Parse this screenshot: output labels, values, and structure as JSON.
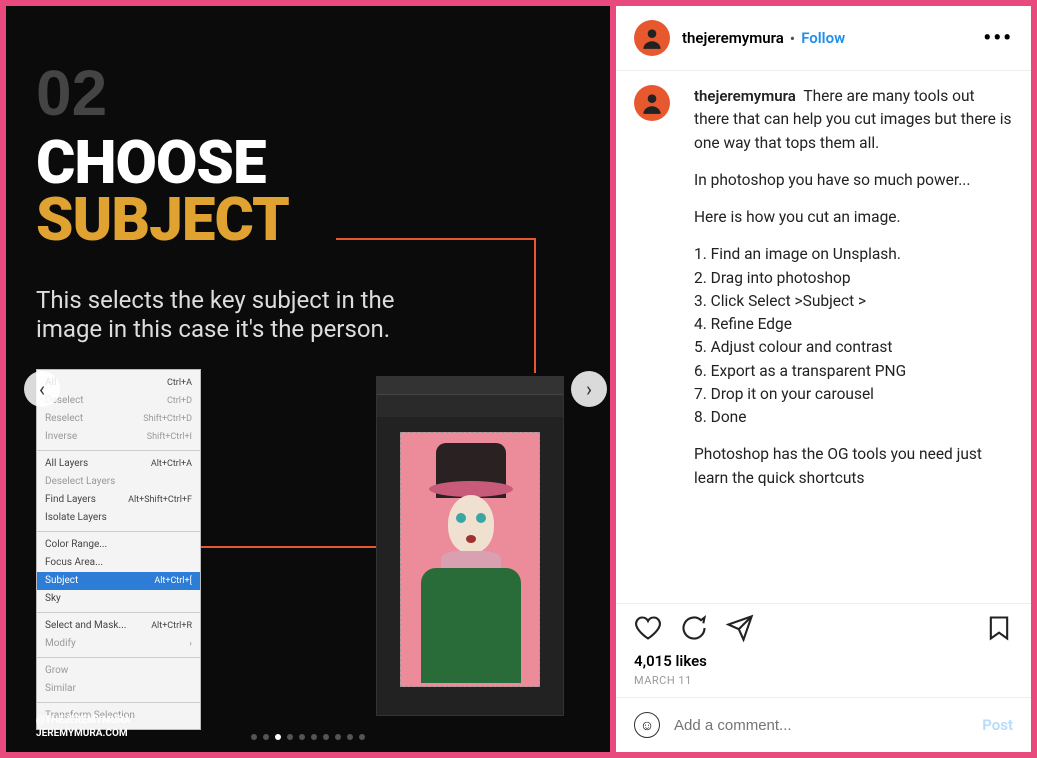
{
  "carousel": {
    "number": "02",
    "title_line1": "CHOOSE",
    "title_line2": "SUBJECT",
    "subtitle": "This selects the key subject in the image in this case it's the person.",
    "menu": [
      {
        "items": [
          {
            "label": "All",
            "sc": "Ctrl+A"
          },
          {
            "label": "Deselect",
            "sc": "Ctrl+D",
            "dim": true
          },
          {
            "label": "Reselect",
            "sc": "Shift+Ctrl+D",
            "dim": true
          },
          {
            "label": "Inverse",
            "sc": "Shift+Ctrl+I",
            "dim": true
          }
        ]
      },
      {
        "items": [
          {
            "label": "All Layers",
            "sc": "Alt+Ctrl+A"
          },
          {
            "label": "Deselect Layers",
            "sc": "",
            "dim": true
          },
          {
            "label": "Find Layers",
            "sc": "Alt+Shift+Ctrl+F"
          },
          {
            "label": "Isolate Layers",
            "sc": ""
          }
        ]
      },
      {
        "items": [
          {
            "label": "Color Range...",
            "sc": ""
          },
          {
            "label": "Focus Area...",
            "sc": ""
          },
          {
            "label": "Subject",
            "sc": "Alt+Ctrl+[",
            "sel": true
          },
          {
            "label": "Sky",
            "sc": ""
          }
        ]
      },
      {
        "items": [
          {
            "label": "Select and Mask...",
            "sc": "Alt+Ctrl+R"
          },
          {
            "label": "Modify",
            "sc": "›",
            "dim": true
          }
        ]
      },
      {
        "items": [
          {
            "label": "Grow",
            "sc": "",
            "dim": true
          },
          {
            "label": "Similar",
            "sc": "",
            "dim": true
          }
        ]
      },
      {
        "items": [
          {
            "label": "Transform Selection",
            "sc": "",
            "dim": true
          }
        ]
      }
    ],
    "handle1": "@THEJEREMYMURA",
    "handle2": "JEREMYMURA.COM",
    "total_dots": 10,
    "active_dot": 2
  },
  "post": {
    "username": "thejeremymura",
    "follow": "Follow",
    "caption_intro": "There are many tools out there that can help you cut images but there is one way that tops them all.",
    "caption_p2": "In photoshop you have so much power...",
    "caption_p3": "Here is how you cut an image.",
    "steps": [
      "1. Find an image on Unsplash.",
      "2. Drag into photoshop",
      "3. Click Select >Subject >",
      "4. Refine Edge",
      "5. Adjust colour and contrast",
      "6. Export as a transparent PNG",
      "7. Drop it on your carousel",
      "8. Done"
    ],
    "caption_p4": "Photoshop has the OG tools you need just learn the quick shortcuts",
    "likes": "4,015 likes",
    "date": "MARCH 11",
    "comment_placeholder": "Add a comment...",
    "post_btn": "Post"
  }
}
